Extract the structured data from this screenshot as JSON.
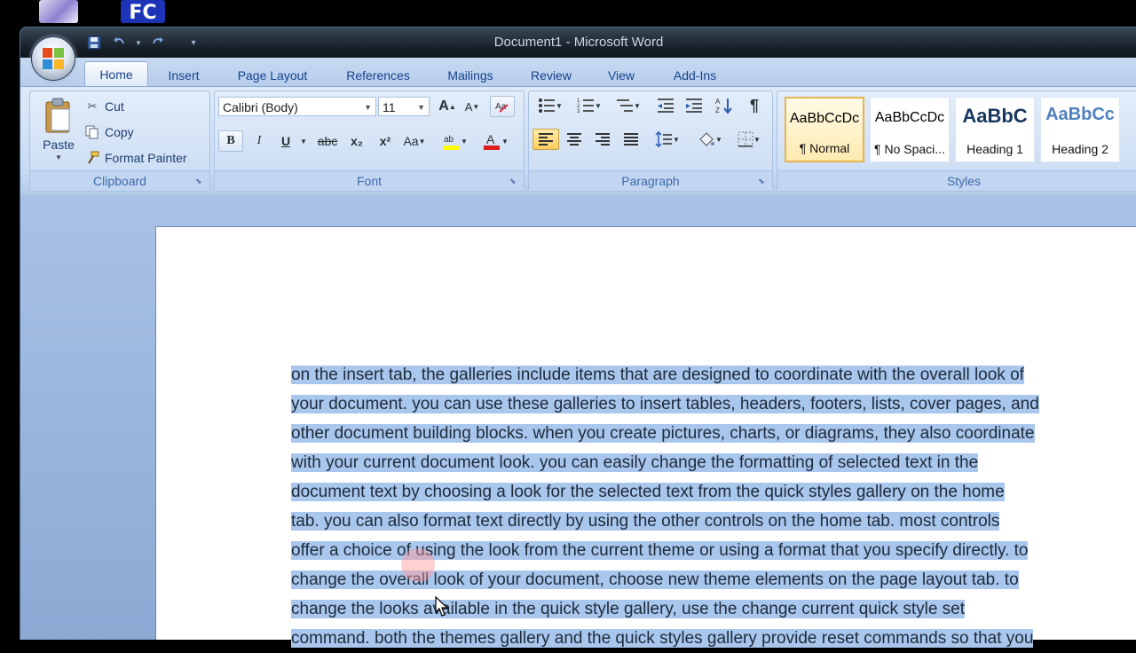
{
  "desktop": {
    "icon1_name": "app-shortcut-icon",
    "icon2_name": "fc-shortcut-icon",
    "icon2_text": "FC"
  },
  "window": {
    "title": "Document1 - Microsoft Word"
  },
  "tabs": [
    {
      "label": "Home",
      "active": true
    },
    {
      "label": "Insert"
    },
    {
      "label": "Page Layout"
    },
    {
      "label": "References"
    },
    {
      "label": "Mailings"
    },
    {
      "label": "Review"
    },
    {
      "label": "View"
    },
    {
      "label": "Add-Ins"
    }
  ],
  "clipboard": {
    "group_label": "Clipboard",
    "paste": "Paste",
    "cut": "Cut",
    "copy": "Copy",
    "format_painter": "Format Painter"
  },
  "font": {
    "group_label": "Font",
    "font_name": "Calibri (Body)",
    "font_size": "11",
    "bold": "B",
    "italic": "I",
    "underline": "U",
    "strike": "abc",
    "subscript": "x₂",
    "superscript": "x²",
    "change_case": "Aa",
    "grow": "A",
    "shrink": "A"
  },
  "paragraph": {
    "group_label": "Paragraph"
  },
  "styles": {
    "group_label": "Styles",
    "items": [
      {
        "sample": "AaBbCcDc",
        "name": "¶ Normal"
      },
      {
        "sample": "AaBbCcDc",
        "name": "¶ No Spaci..."
      },
      {
        "sample": "AaBbC",
        "name": "Heading 1"
      },
      {
        "sample": "AaBbCc",
        "name": "Heading 2"
      }
    ]
  },
  "document": {
    "lines": [
      "on the insert tab, the galleries include items that are designed to coordinate with the overall look of",
      "your document. you can use these galleries to insert tables, headers, footers, lists, cover pages, and",
      "other document building blocks. when you create pictures, charts, or diagrams, they also coordinate",
      "with your current document look. you can easily change the formatting of selected text in the",
      "document text by choosing a look for the selected text from the quick styles gallery on the home",
      "tab. you can also format text directly by using the other controls on the home tab. most controls",
      "offer a choice of using the look from the current theme or using a format that you specify directly. to",
      "change the overall look of your document, choose new theme elements on the page layout tab. to",
      "change the looks available in the quick style gallery, use the change current quick style set",
      "command. both the themes gallery and the quick styles gallery provide reset commands so that you"
    ]
  }
}
